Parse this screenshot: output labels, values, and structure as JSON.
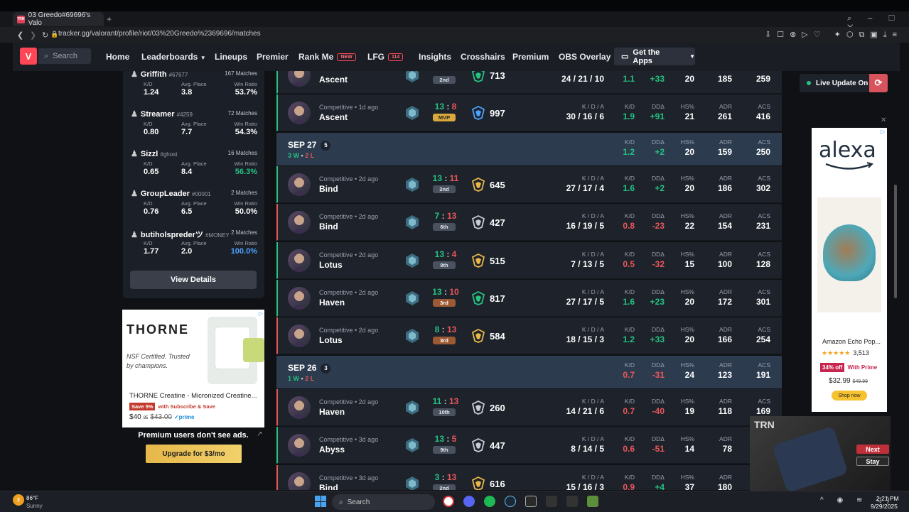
{
  "browser": {
    "tab_title": "03 Greedo#69696's Valo",
    "url": "tracker.gg/valorant/profile/riot/03%20Greedo%2369696/matches",
    "favicon_text": "TRN"
  },
  "site_nav": {
    "search_placeholder": "Search",
    "items": [
      "Home",
      "Leaderboards",
      "Lineups",
      "Premier",
      "Rank Me",
      "LFG",
      "Insights",
      "Crosshairs",
      "Premium",
      "OBS Overlay"
    ],
    "rank_me_badge": "NEW",
    "lfg_badge": "114",
    "get_apps": "Get the Apps"
  },
  "played_with": [
    {
      "name": "Griffith",
      "tag": "#67677",
      "matches": "167 Matches",
      "kd": "1.24",
      "avg_place": "3.8",
      "win_ratio": "53.7%",
      "wr_color": "#ffffff"
    },
    {
      "name": "Streamer",
      "tag": "#4259",
      "matches": "72 Matches",
      "kd": "0.80",
      "avg_place": "7.7",
      "win_ratio": "54.3%",
      "wr_color": "#ffffff"
    },
    {
      "name": "Sizzl",
      "tag": "#ghost",
      "matches": "16 Matches",
      "kd": "0.65",
      "avg_place": "8.4",
      "win_ratio": "56.3%",
      "wr_color": "#25c281"
    },
    {
      "name": "GroupLeader",
      "tag": "#00001",
      "matches": "2 Matches",
      "kd": "0.76",
      "avg_place": "6.5",
      "win_ratio": "50.0%",
      "wr_color": "#ffffff"
    },
    {
      "name": "butiholsprederツ",
      "tag": "#MONEY",
      "matches": "2 Matches",
      "kd": "1.77",
      "avg_place": "2.0",
      "win_ratio": "100.0%",
      "wr_color": "#4ba3ff"
    }
  ],
  "played_with_labels": {
    "kd": "K/D",
    "avg_place": "Avg. Place",
    "win_ratio": "Win Ratio"
  },
  "view_details": "View Details",
  "ad_left": {
    "brand": "THORNE",
    "tagline": "NSF Certified. Trusted by champions.",
    "product": "THORNE Creatine - Micronized Creatine...",
    "save_badge": "Save 5%",
    "save_text": "with Subscribe & Save",
    "price": "$40",
    "price_cents": "85",
    "old_price": "$43.00",
    "prime": "✓prime"
  },
  "premium_text": "Premium users don't see ads.",
  "upgrade_label": "Upgrade for $3/mo",
  "stat_labels": {
    "kda": "K / D / A",
    "kd": "K/D",
    "ddd": "DDΔ",
    "hs": "HS%",
    "adr": "ADR",
    "acs": "ACS"
  },
  "matches": [
    {
      "kind": "match",
      "result": "win",
      "meta": "",
      "map": "Ascent",
      "score_a": "",
      "score_b": "",
      "place": "2nd",
      "place_style": "gray",
      "rr": "713",
      "rr_color": "#25c281",
      "kda": "24 / 21 / 10",
      "kd": "1.1",
      "kd_c": "g",
      "ddd": "+33",
      "ddd_c": "g",
      "hs": "20",
      "adr": "185",
      "acs": "259"
    },
    {
      "kind": "match",
      "result": "win",
      "meta": "Competitive • 1d ago",
      "map": "Ascent",
      "score_a": "13",
      "score_b": "8",
      "score_a_c": "g",
      "score_b_c": "r",
      "place": "MVP",
      "place_style": "gold",
      "rr": "997",
      "rr_color": "#4ba3ff",
      "kda": "30 / 16 / 6",
      "kd": "1.9",
      "kd_c": "g",
      "ddd": "+91",
      "ddd_c": "g",
      "hs": "21",
      "adr": "261",
      "acs": "416"
    },
    {
      "kind": "group",
      "date": "SEP 27",
      "count": "5",
      "wins": "3 W",
      "losses": "2 L",
      "kd": "1.2",
      "kd_c": "g",
      "ddd": "+2",
      "ddd_c": "g",
      "hs": "20",
      "adr": "159",
      "acs": "250"
    },
    {
      "kind": "match",
      "result": "win",
      "meta": "Competitive • 2d ago",
      "map": "Bind",
      "score_a": "13",
      "score_b": "11",
      "score_a_c": "g",
      "score_b_c": "r",
      "place": "2nd",
      "place_style": "gray",
      "rr": "645",
      "rr_color": "#e8b84a",
      "kda": "27 / 17 / 4",
      "kd": "1.6",
      "kd_c": "g",
      "ddd": "+2",
      "ddd_c": "g",
      "hs": "20",
      "adr": "186",
      "acs": "302"
    },
    {
      "kind": "match",
      "result": "loss",
      "meta": "Competitive • 2d ago",
      "map": "Bind",
      "score_a": "7",
      "score_b": "13",
      "score_a_c": "g",
      "score_b_c": "r",
      "place": "6th",
      "place_style": "gray",
      "rr": "427",
      "rr_color": "#c7ccd4",
      "kda": "16 / 19 / 5",
      "kd": "0.8",
      "kd_c": "r",
      "ddd": "-23",
      "ddd_c": "r",
      "hs": "22",
      "adr": "154",
      "acs": "231"
    },
    {
      "kind": "match",
      "result": "win",
      "meta": "Competitive • 2d ago",
      "map": "Lotus",
      "score_a": "13",
      "score_b": "4",
      "score_a_c": "g",
      "score_b_c": "r",
      "place": "9th",
      "place_style": "gray",
      "rr": "515",
      "rr_color": "#e8b84a",
      "kda": "7 / 13 / 5",
      "kd": "0.5",
      "kd_c": "r",
      "ddd": "-32",
      "ddd_c": "r",
      "hs": "15",
      "adr": "100",
      "acs": "128"
    },
    {
      "kind": "match",
      "result": "win",
      "meta": "Competitive • 2d ago",
      "map": "Haven",
      "score_a": "13",
      "score_b": "10",
      "score_a_c": "g",
      "score_b_c": "r",
      "place": "3rd",
      "place_style": "brown",
      "rr": "817",
      "rr_color": "#25c281",
      "kda": "27 / 17 / 5",
      "kd": "1.6",
      "kd_c": "g",
      "ddd": "+23",
      "ddd_c": "g",
      "hs": "20",
      "adr": "172",
      "acs": "301"
    },
    {
      "kind": "match",
      "result": "loss",
      "meta": "Competitive • 2d ago",
      "map": "Lotus",
      "score_a": "8",
      "score_b": "13",
      "score_a_c": "g",
      "score_b_c": "r",
      "place": "3rd",
      "place_style": "brown",
      "rr": "584",
      "rr_color": "#e8b84a",
      "kda": "18 / 15 / 3",
      "kd": "1.2",
      "kd_c": "g",
      "ddd": "+33",
      "ddd_c": "g",
      "hs": "20",
      "adr": "166",
      "acs": "254"
    },
    {
      "kind": "group",
      "date": "SEP 26",
      "count": "3",
      "wins": "1 W",
      "losses": "2 L",
      "kd": "0.7",
      "kd_c": "r",
      "ddd": "-31",
      "ddd_c": "r",
      "hs": "24",
      "adr": "123",
      "acs": "191"
    },
    {
      "kind": "match",
      "result": "loss",
      "meta": "Competitive • 2d ago",
      "map": "Haven",
      "score_a": "11",
      "score_b": "13",
      "score_a_c": "g",
      "score_b_c": "r",
      "place": "10th",
      "place_style": "gray",
      "rr": "260",
      "rr_color": "#c7ccd4",
      "kda": "14 / 21 / 6",
      "kd": "0.7",
      "kd_c": "r",
      "ddd": "-40",
      "ddd_c": "r",
      "hs": "19",
      "adr": "118",
      "acs": "169"
    },
    {
      "kind": "match",
      "result": "win",
      "meta": "Competitive • 3d ago",
      "map": "Abyss",
      "score_a": "13",
      "score_b": "5",
      "score_a_c": "g",
      "score_b_c": "r",
      "place": "9th",
      "place_style": "gray",
      "rr": "447",
      "rr_color": "#c7ccd4",
      "kda": "8 / 14 / 5",
      "kd": "0.6",
      "kd_c": "r",
      "ddd": "-51",
      "ddd_c": "r",
      "hs": "14",
      "adr": "78",
      "acs": ""
    },
    {
      "kind": "match",
      "result": "loss",
      "meta": "Competitive • 3d ago",
      "map": "Bind",
      "score_a": "3",
      "score_b": "13",
      "score_a_c": "g",
      "score_b_c": "r",
      "place": "2nd",
      "place_style": "gray",
      "rr": "616",
      "rr_color": "#e8b84a",
      "kda": "15 / 16 / 3",
      "kd": "0.9",
      "kd_c": "r",
      "ddd": "+4",
      "ddd_c": "g",
      "hs": "37",
      "adr": "180",
      "acs": ""
    }
  ],
  "live_update": "Live Update On",
  "ad_right": {
    "brand": "alexa",
    "product": "Amazon Echo Pop...",
    "rating_count": "3,513",
    "discount": "34% off",
    "prime": "With Prime",
    "price": "$32.99",
    "old_price": "$49.99",
    "cta": "Shop now"
  },
  "video": {
    "logo": "TRN",
    "next": "Next",
    "stay": "Stay"
  },
  "taskbar": {
    "weather_temp": "86°F",
    "weather_desc": "Sunny",
    "weather_badge": "2",
    "search": "Search",
    "time": "2:21 PM",
    "date": "9/29/2025"
  },
  "colors": {
    "accent": "#ff4655",
    "win": "#25c281",
    "loss": "#e8575a"
  }
}
